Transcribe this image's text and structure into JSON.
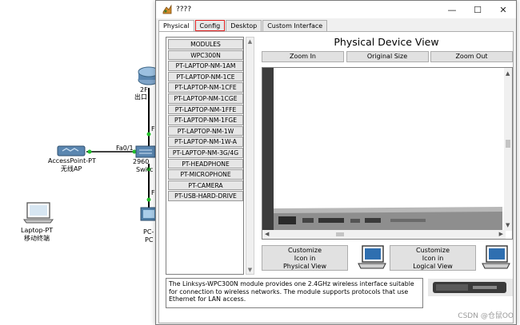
{
  "topology": {
    "router_label_1": "2F",
    "router_label_2": "出口",
    "ap_label": "AccessPoint-PT",
    "ap_sublabel": "无线AP",
    "link_label": "Fa0/1",
    "switch_label": "2960",
    "switch_sublabel": "Switc",
    "port_label_1": "F",
    "port_label_2": "F",
    "pc_label": "PC-",
    "pc_sublabel": "PC",
    "laptop_label": "Laptop-PT",
    "laptop_sublabel": "移动终端"
  },
  "window": {
    "title": "????",
    "controls": {
      "minimize": "—",
      "maximize": "☐",
      "close": "✕"
    }
  },
  "tabs": [
    {
      "label": "Physical",
      "active": true
    },
    {
      "label": "Config",
      "highlighted": true
    },
    {
      "label": "Desktop"
    },
    {
      "label": "Custom Interface"
    }
  ],
  "modules": {
    "header": "MODULES",
    "items": [
      "WPC300N",
      "PT-LAPTOP-NM-1AM",
      "PT-LAPTOP-NM-1CE",
      "PT-LAPTOP-NM-1CFE",
      "PT-LAPTOP-NM-1CGE",
      "PT-LAPTOP-NM-1FFE",
      "PT-LAPTOP-NM-1FGE",
      "PT-LAPTOP-NM-1W",
      "PT-LAPTOP-NM-1W-A",
      "PT-LAPTOP-NM-3G/4G",
      "PT-HEADPHONE",
      "PT-MICROPHONE",
      "PT-CAMERA",
      "PT-USB-HARD-DRIVE"
    ]
  },
  "device_view": {
    "title": "Physical Device View",
    "zoom_in": "Zoom In",
    "original_size": "Original Size",
    "zoom_out": "Zoom Out",
    "customize_physical": [
      "Customize",
      "Icon in",
      "Physical View"
    ],
    "customize_logical": [
      "Customize",
      "Icon in",
      "Logical View"
    ]
  },
  "description": "The Linksys-WPC300N module provides one 2.4GHz wireless interface suitable for connection to wireless networks. The module supports protocols that use Ethernet for LAN access.",
  "watermark": "CSDN @仓鼠OO",
  "colors": {
    "link_green": "#22c02a",
    "tab_highlight": "#e02020",
    "router_blue": "#5a86b0"
  }
}
